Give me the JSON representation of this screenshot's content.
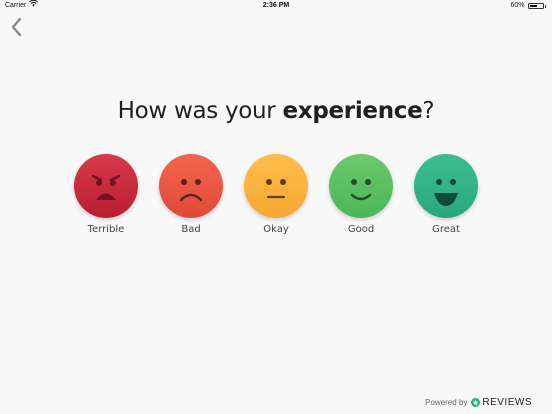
{
  "status_bar": {
    "carrier": "Carrier",
    "time": "2:36 PM",
    "battery_percent": "60%",
    "battery_level": 0.6
  },
  "title": {
    "prefix": "How was your ",
    "emphasis": "experience",
    "suffix": "?"
  },
  "ratings": [
    {
      "label": "Terrible",
      "icon": "angry-face-icon",
      "color_top": "#d8394a",
      "color_bottom": "#b81f33"
    },
    {
      "label": "Bad",
      "icon": "sad-face-icon",
      "color_top": "#f4654d",
      "color_bottom": "#e04a38"
    },
    {
      "label": "Okay",
      "icon": "neutral-face-icon",
      "color_top": "#ffbd4a",
      "color_bottom": "#f7a733"
    },
    {
      "label": "Good",
      "icon": "smiling-face-icon",
      "color_top": "#6bc96a",
      "color_bottom": "#4db558"
    },
    {
      "label": "Great",
      "icon": "grinning-face-icon",
      "color_top": "#3bbf8f",
      "color_bottom": "#2aa67e"
    }
  ],
  "footer": {
    "powered_by": "Powered by",
    "brand": "REVIEWS",
    "brand_color": "#1db87a"
  }
}
